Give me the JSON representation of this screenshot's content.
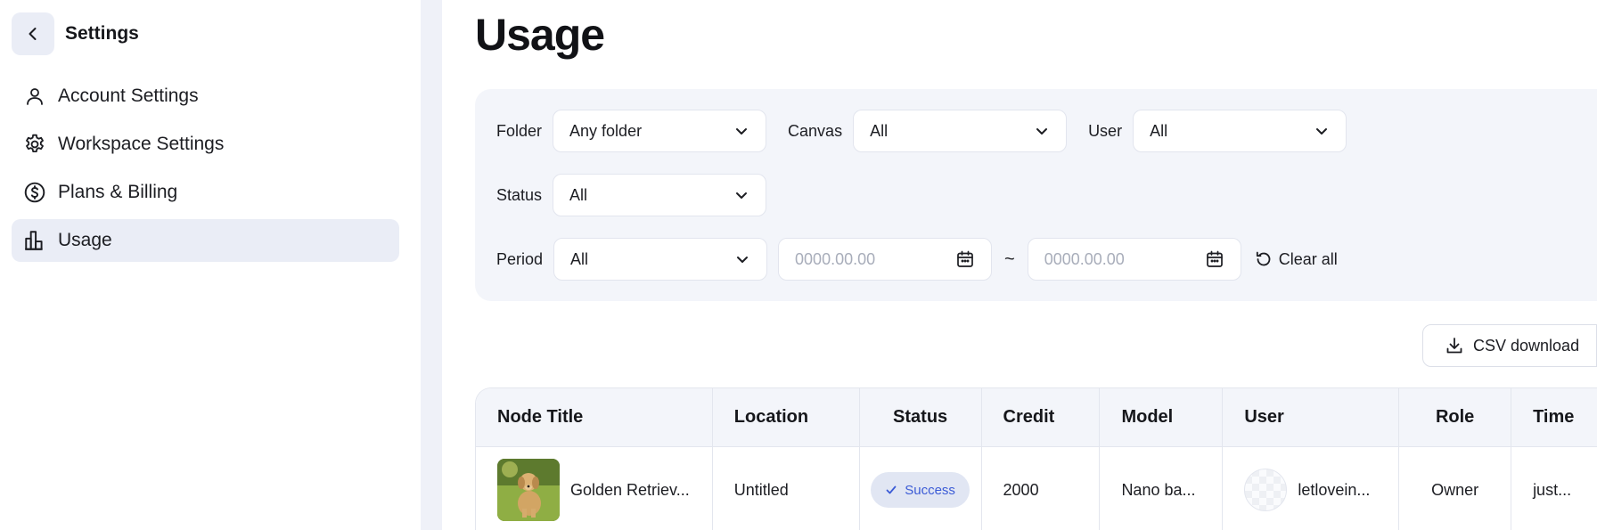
{
  "sidebar": {
    "title": "Settings",
    "items": [
      {
        "label": "Account Settings",
        "icon": "user-icon",
        "active": false
      },
      {
        "label": "Workspace Settings",
        "icon": "gear-icon",
        "active": false
      },
      {
        "label": "Plans & Billing",
        "icon": "dollar-icon",
        "active": false
      },
      {
        "label": "Usage",
        "icon": "bar-chart-icon",
        "active": true
      }
    ]
  },
  "main": {
    "title": "Usage",
    "filters": {
      "folder": {
        "label": "Folder",
        "value": "Any folder"
      },
      "canvas": {
        "label": "Canvas",
        "value": "All"
      },
      "user": {
        "label": "User",
        "value": "All"
      },
      "status": {
        "label": "Status",
        "value": "All"
      },
      "period": {
        "label": "Period",
        "value": "All"
      },
      "date_start_placeholder": "0000.00.00",
      "date_end_placeholder": "0000.00.00",
      "date_separator": "~",
      "clear_label": "Clear all"
    },
    "csv_label": "CSV download",
    "table": {
      "headers": [
        "Node Title",
        "Location",
        "Status",
        "Credit",
        "Model",
        "User",
        "Role",
        "Time"
      ],
      "rows": [
        {
          "node_title": "Golden Retriev...",
          "location": "Untitled",
          "status": "Success",
          "credit": "2000",
          "model": "Nano ba...",
          "user": "letlovein...",
          "role": "Owner",
          "time": "just..."
        }
      ]
    }
  },
  "colors": {
    "accent_bg": "#eaedf6",
    "panel_bg": "#f3f5fa",
    "success_text": "#3b5bd6",
    "success_bg": "#e1e6f3"
  }
}
